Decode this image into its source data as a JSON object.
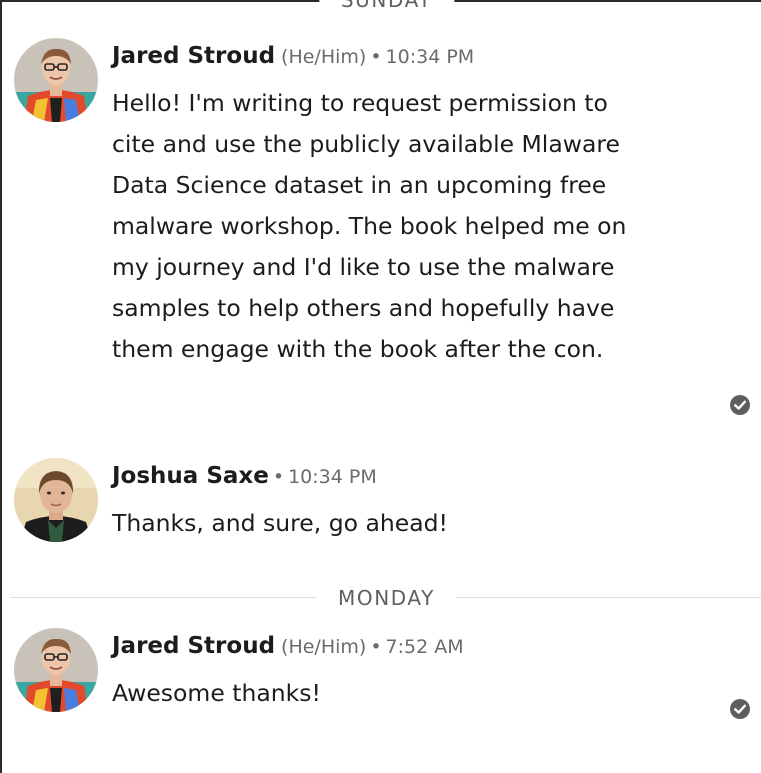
{
  "days": {
    "top_label": "SUNDAY",
    "mid_label": "MONDAY"
  },
  "messages": [
    {
      "author": "Jared Stroud",
      "pronouns": "(He/Him)",
      "separator": "•",
      "time": "10:34 PM",
      "text": "Hello! I'm writing to request permission to cite and use the publicly available Mlaware Data Science dataset in an upcoming free malware workshop. The book helped me on my journey and I'd like to use the malware samples to help others and hopefully have them engage with the book after the con.",
      "read_status_icon": "check-circle-icon"
    },
    {
      "author": "Joshua Saxe",
      "separator": "•",
      "time": "10:34 PM",
      "text": "Thanks, and sure, go ahead!"
    },
    {
      "author": "Jared Stroud",
      "pronouns": "(He/Him)",
      "separator": "•",
      "time": "7:52 AM",
      "text": "Awesome thanks!",
      "read_status_icon": "check-circle-icon"
    }
  ],
  "colors": {
    "text": "#1d1c1d",
    "muted": "#6b6b6b",
    "divider": "#dddddd",
    "check": "#5e5e5e"
  }
}
